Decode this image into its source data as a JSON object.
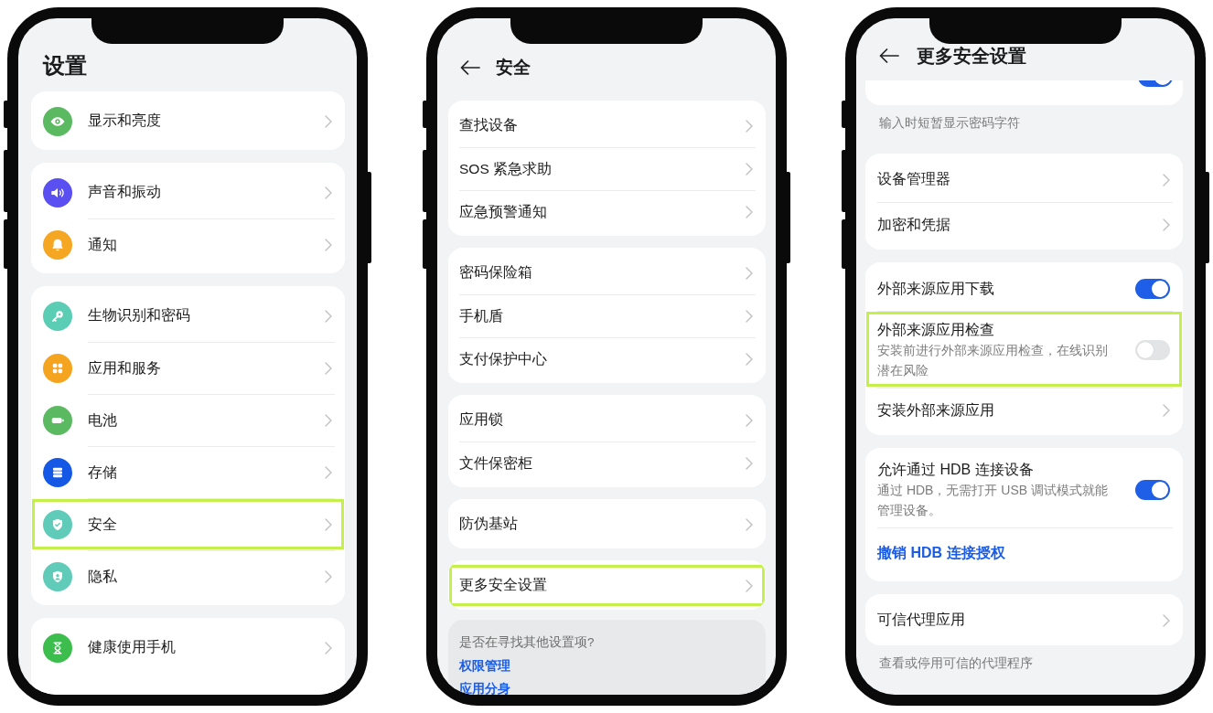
{
  "phones": [
    {
      "header": {
        "title": "设置",
        "back": false
      },
      "sections": [
        {
          "kind": "card",
          "rows": [
            {
              "kind": "nav",
              "label": "显示和亮度",
              "color": "#5bb962",
              "highlighted": false
            }
          ]
        },
        {
          "kind": "card",
          "rows": [
            {
              "kind": "nav",
              "label": "声音和振动",
              "color": "#5a4ff0",
              "highlighted": false
            },
            {
              "kind": "nav",
              "label": "通知",
              "color": "#f5a623",
              "highlighted": false
            }
          ]
        },
        {
          "kind": "card",
          "rows": [
            {
              "kind": "nav",
              "label": "生物识别和密码",
              "color": "#5ccdb5",
              "highlighted": false
            },
            {
              "kind": "nav",
              "label": "应用和服务",
              "color": "#f5a41f",
              "highlighted": false
            },
            {
              "kind": "nav",
              "label": "电池",
              "color": "#5bb962",
              "highlighted": false
            },
            {
              "kind": "nav",
              "label": "存储",
              "color": "#1558e6",
              "highlighted": false
            },
            {
              "kind": "nav",
              "label": "安全",
              "color": "#5fcbb8",
              "highlighted": true
            },
            {
              "kind": "nav",
              "label": "隐私",
              "color": "#5fcbb8",
              "highlighted": false
            }
          ]
        },
        {
          "kind": "card",
          "rows": [
            {
              "kind": "nav",
              "label": "健康使用手机",
              "color": "#3cbd4e",
              "highlighted": false
            }
          ]
        }
      ]
    },
    {
      "header": {
        "title": "安全",
        "back": true
      },
      "sections": [
        {
          "kind": "card",
          "rows": [
            {
              "kind": "nav",
              "label": "查找设备",
              "highlighted": false
            },
            {
              "kind": "nav",
              "label": "SOS 紧急求助",
              "highlighted": false
            },
            {
              "kind": "nav",
              "label": "应急预警通知",
              "highlighted": false
            }
          ]
        },
        {
          "kind": "card",
          "rows": [
            {
              "kind": "nav",
              "label": "密码保险箱",
              "highlighted": false
            },
            {
              "kind": "nav",
              "label": "手机盾",
              "highlighted": false
            },
            {
              "kind": "nav",
              "label": "支付保护中心",
              "highlighted": false
            }
          ]
        },
        {
          "kind": "card",
          "rows": [
            {
              "kind": "nav",
              "label": "应用锁",
              "highlighted": false
            },
            {
              "kind": "nav",
              "label": "文件保密柜",
              "highlighted": false
            }
          ]
        },
        {
          "kind": "card",
          "rows": [
            {
              "kind": "nav",
              "label": "防伪基站",
              "highlighted": false
            }
          ]
        },
        {
          "kind": "card",
          "rows": [
            {
              "kind": "nav",
              "label": "更多安全设置",
              "highlighted": true
            }
          ]
        },
        {
          "kind": "suggestions",
          "prompt": "是否在寻找其他设置项?",
          "links": [
            "权限管理",
            "应用分身"
          ]
        }
      ]
    },
    {
      "header": {
        "title": "更多安全设置",
        "back": true
      },
      "sections": [
        {
          "kind": "clipped_card",
          "toggle": {
            "on": true
          }
        },
        {
          "kind": "note",
          "text": "输入时短暂显示密码字符"
        },
        {
          "kind": "card",
          "rows": [
            {
              "kind": "nav",
              "label": "设备管理器",
              "highlighted": false
            },
            {
              "kind": "nav",
              "label": "加密和凭据",
              "highlighted": false
            }
          ]
        },
        {
          "kind": "card",
          "rows": [
            {
              "kind": "toggle",
              "label": "外部来源应用下载",
              "on": true,
              "highlighted": false
            },
            {
              "kind": "toggle",
              "label": "外部来源应用检查",
              "subtitle": "安装前进行外部来源应用检查，在线识别潜在风险",
              "on": false,
              "highlighted": true
            },
            {
              "kind": "nav",
              "label": "安装外部来源应用",
              "highlighted": false
            }
          ]
        },
        {
          "kind": "card",
          "rows": [
            {
              "kind": "toggle",
              "label": "允许通过 HDB 连接设备",
              "subtitle": "通过 HDB，无需打开 USB 调试模式就能管理设备。",
              "on": true,
              "highlighted": false
            },
            {
              "kind": "action",
              "label": "撤销 HDB 连接授权",
              "highlighted": false
            }
          ]
        },
        {
          "kind": "card",
          "rows": [
            {
              "kind": "nav",
              "label": "可信代理应用",
              "highlighted": false
            }
          ]
        },
        {
          "kind": "note",
          "text": "查看或停用可信的代理程序"
        }
      ]
    }
  ]
}
